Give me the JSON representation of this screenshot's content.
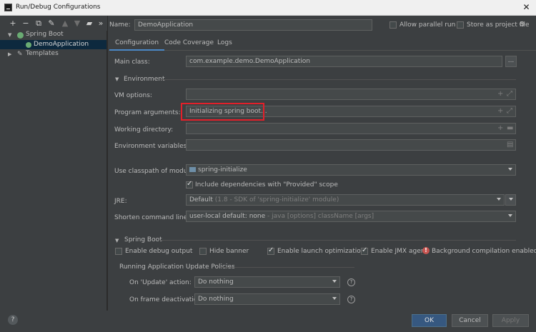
{
  "window": {
    "title": "Run/Debug Configurations"
  },
  "toolbar": {
    "add": "+",
    "remove": "−",
    "copy": "⧉",
    "edit": "🔧",
    "up": "▲",
    "down": "▼",
    "folder": "📁",
    "more": "»"
  },
  "tree": {
    "spring_boot": "Spring Boot",
    "demo_app": "DemoApplication",
    "templates": "Templates"
  },
  "header": {
    "name_label": "Name:",
    "name_value": "DemoApplication",
    "allow_parallel": "Allow parallel run",
    "store_project": "Store as project file"
  },
  "tabs": [
    "Configuration",
    "Code Coverage",
    "Logs"
  ],
  "form": {
    "main_class_label": "Main class:",
    "main_class_value": "com.example.demo.DemoApplication",
    "main_class_btn": "...",
    "environment_section": "Environment",
    "vm_options_label": "VM options:",
    "program_args_label": "Program arguments:",
    "program_args_value": "Initializing spring boot...",
    "working_dir_label": "Working directory:",
    "env_vars_label": "Environment variables:",
    "classpath_label": "Use classpath of module:",
    "classpath_value": "spring-initialize",
    "include_provided": "Include dependencies with \"Provided\" scope",
    "jre_label": "JRE:",
    "jre_value": "Default",
    "jre_hint": "(1.8 - SDK of 'spring-initialize' module)",
    "shorten_label": "Shorten command line:",
    "shorten_value": "user-local default: none",
    "shorten_hint": "- java [options] className [args]"
  },
  "spring_boot": {
    "section": "Spring Boot",
    "debug_output": "Enable debug output",
    "hide_banner": "Hide banner",
    "launch_opt": "Enable launch optimization",
    "jmx_agent": "Enable JMX agent",
    "bg_compile": "Background compilation enabled",
    "policies_title": "Running Application Update Policies",
    "on_update_label": "On 'Update' action:",
    "on_update_value": "Do nothing",
    "on_frame_label": "On frame deactivation:",
    "on_frame_value": "Do nothing"
  },
  "buttons": {
    "ok": "OK",
    "cancel": "Cancel",
    "apply": "Apply",
    "help": "?"
  },
  "colors": {
    "accent": "#4a88c7",
    "highlight": "#e2202a",
    "primary_button": "#365880"
  }
}
